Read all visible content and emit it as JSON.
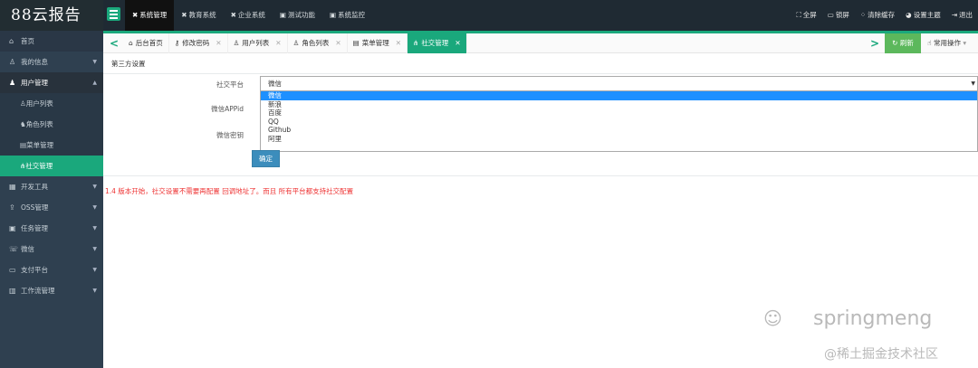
{
  "logo": "88云报告",
  "top_nav": [
    {
      "icon": "✖",
      "label": "系统管理",
      "active": true
    },
    {
      "icon": "✖",
      "label": "教育系统"
    },
    {
      "icon": "✖",
      "label": "企业系统"
    },
    {
      "icon": "▣",
      "label": "测试功能"
    },
    {
      "icon": "▣",
      "label": "系统监控"
    }
  ],
  "top_right": [
    {
      "icon": "⛶",
      "label": "全屏"
    },
    {
      "icon": "▭",
      "label": "锁屏"
    },
    {
      "icon": "⁘",
      "label": "清除缓存"
    },
    {
      "icon": "◕",
      "label": "设置主题"
    },
    {
      "icon": "⇥",
      "label": "退出"
    }
  ],
  "sidebar": {
    "home": "首页",
    "my_info": "我的信息",
    "user_mgmt": "用户管理",
    "user_list": "用户列表",
    "role_list": "角色列表",
    "menu_mgmt": "菜单管理",
    "social_mgmt": "社交管理",
    "dev_tools": "开发工具",
    "oss_mgmt": "OSS管理",
    "task_mgmt": "任务管理",
    "wechat": "微信",
    "payment": "支付平台",
    "workflow": "工作流管理"
  },
  "tabs": [
    {
      "icon": "⌂",
      "label": "后台首页",
      "closable": false
    },
    {
      "icon": "⚷",
      "label": "修改密码",
      "closable": true
    },
    {
      "icon": "♙",
      "label": "用户列表",
      "closable": true
    },
    {
      "icon": "♙",
      "label": "角色列表",
      "closable": true
    },
    {
      "icon": "▤",
      "label": "菜单管理",
      "closable": true
    },
    {
      "icon": "⋔",
      "label": "社交管理",
      "closable": true,
      "active": true
    }
  ],
  "tab_close": "✕",
  "refresh_label": "刷新",
  "common_ops_label": "常用操作",
  "panel_title": "第三方设置",
  "form": {
    "platform_label": "社交平台",
    "appid_label": "微信APPid",
    "secret_label": "微信密钥",
    "selected_value": "微信",
    "options": [
      "微信",
      "新浪",
      "百度",
      "QQ",
      "Github",
      "阿里"
    ],
    "confirm_label": "确定"
  },
  "note": "1.4 版本开始，社交设置不需要再配置 回调地址了。而且 所有平台都支持社交配置",
  "watermark_1": "springmeng",
  "watermark_2": "@稀土掘金技术社区",
  "colors": {
    "accent": "#1aa87c",
    "sidebar": "#2f4050",
    "topbar": "#1f2a33",
    "note": "#e33333"
  }
}
